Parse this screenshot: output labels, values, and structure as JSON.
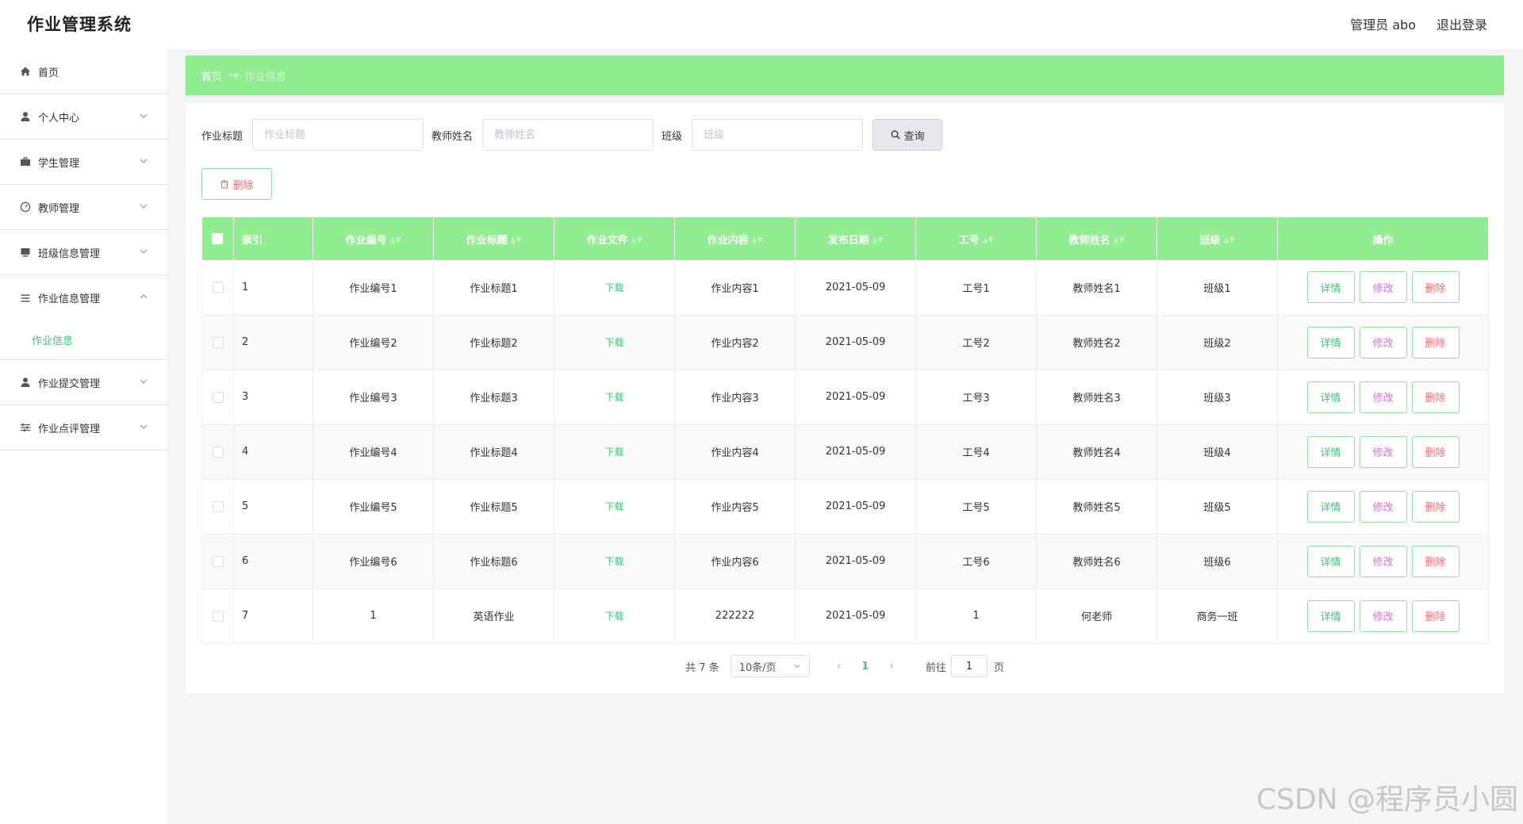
{
  "header": {
    "app_title": "作业管理系统",
    "user_label": "管理员 abo",
    "logout_label": "退出登录"
  },
  "sidebar": {
    "items": [
      {
        "label": "首页",
        "icon": "home-icon"
      },
      {
        "label": "个人中心",
        "icon": "user-icon"
      },
      {
        "label": "学生管理",
        "icon": "briefcase-icon"
      },
      {
        "label": "教师管理",
        "icon": "gauge-icon"
      },
      {
        "label": "班级信息管理",
        "icon": "monitor-icon"
      },
      {
        "label": "作业信息管理",
        "icon": "list-icon"
      },
      {
        "label": "作业提交管理",
        "icon": "user-icon"
      },
      {
        "label": "作业点评管理",
        "icon": "sliders-icon"
      }
    ],
    "subitem_label": "作业信息"
  },
  "breadcrumb": {
    "home": "首页",
    "arrow": "→",
    "current": "作业信息"
  },
  "search": {
    "title_label": "作业标题",
    "title_placeholder": "作业标题",
    "teacher_label": "教师姓名",
    "teacher_placeholder": "教师姓名",
    "class_label": "班级",
    "class_placeholder": "班级",
    "query_label": "查询"
  },
  "toolbar": {
    "delete_label": "删除"
  },
  "table": {
    "columns": [
      "索引",
      "作业编号",
      "作业标题",
      "作业文件",
      "作业内容",
      "发布日期",
      "工号",
      "教师姓名",
      "班级",
      "操作"
    ],
    "download_label": "下载",
    "actions": {
      "detail": "详情",
      "edit": "修改",
      "delete": "删除"
    },
    "rows": [
      {
        "index": "1",
        "code": "作业编号1",
        "title": "作业标题1",
        "content": "作业内容1",
        "date": "2021-05-09",
        "job_no": "工号1",
        "teacher": "教师姓名1",
        "class": "班级1"
      },
      {
        "index": "2",
        "code": "作业编号2",
        "title": "作业标题2",
        "content": "作业内容2",
        "date": "2021-05-09",
        "job_no": "工号2",
        "teacher": "教师姓名2",
        "class": "班级2"
      },
      {
        "index": "3",
        "code": "作业编号3",
        "title": "作业标题3",
        "content": "作业内容3",
        "date": "2021-05-09",
        "job_no": "工号3",
        "teacher": "教师姓名3",
        "class": "班级3"
      },
      {
        "index": "4",
        "code": "作业编号4",
        "title": "作业标题4",
        "content": "作业内容4",
        "date": "2021-05-09",
        "job_no": "工号4",
        "teacher": "教师姓名4",
        "class": "班级4"
      },
      {
        "index": "5",
        "code": "作业编号5",
        "title": "作业标题5",
        "content": "作业内容5",
        "date": "2021-05-09",
        "job_no": "工号5",
        "teacher": "教师姓名5",
        "class": "班级5"
      },
      {
        "index": "6",
        "code": "作业编号6",
        "title": "作业标题6",
        "content": "作业内容6",
        "date": "2021-05-09",
        "job_no": "工号6",
        "teacher": "教师姓名6",
        "class": "班级6"
      },
      {
        "index": "7",
        "code": "1",
        "title": "英语作业",
        "content": "222222",
        "date": "2021-05-09",
        "job_no": "1",
        "teacher": "何老师",
        "class": "商务一班"
      }
    ]
  },
  "pagination": {
    "total": "共 7 条",
    "page_size": "10条/页",
    "current_page": "1",
    "jump_label": "前往",
    "jump_value": "1",
    "jump_suffix": "页"
  },
  "watermark": "CSDN @程序员小圆",
  "colors": {
    "accent": "#90ee90",
    "link_green": "#3cc57a",
    "danger": "#f56c6c",
    "edit": "#e06dd6"
  }
}
